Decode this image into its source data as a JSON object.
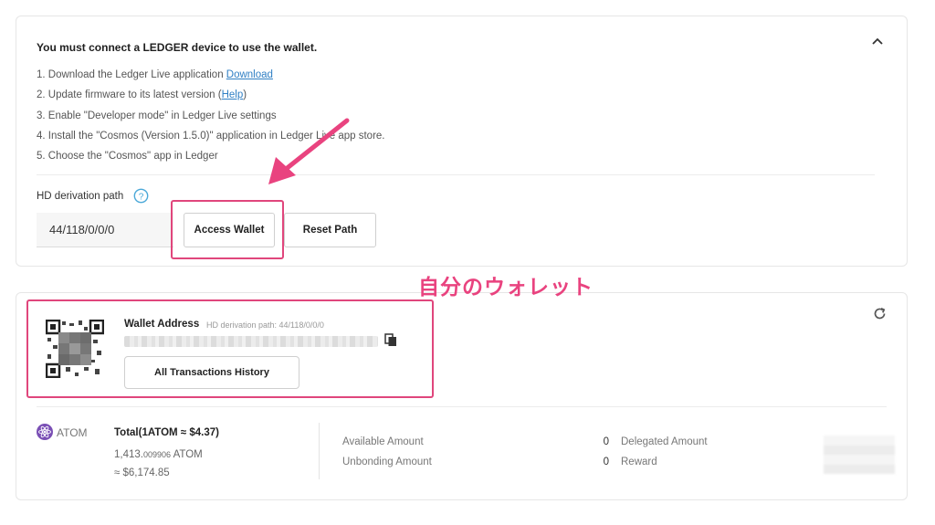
{
  "ledger": {
    "title": "You must connect a LEDGER device to use the wallet.",
    "steps": [
      {
        "text": "1. Download the Ledger Live application ",
        "link": "Download",
        "suffix": ""
      },
      {
        "text": "2. Update firmware to its latest version (",
        "link": "Help",
        "suffix": ")"
      },
      {
        "text": "3. Enable \"Developer mode\" in Ledger Live settings",
        "link": "",
        "suffix": ""
      },
      {
        "text": "4. Install the \"Cosmos (Version 1.5.0)\" application in Ledger Live app store.",
        "link": "",
        "suffix": ""
      },
      {
        "text": "5. Choose the \"Cosmos\" app in Ledger",
        "link": "",
        "suffix": ""
      }
    ],
    "hd_label": "HD derivation path",
    "hd_value": "44/118/0/0/0",
    "access_label": "Access Wallet",
    "reset_label": "Reset Path"
  },
  "annotation": {
    "label": "自分のウォレット",
    "color": "#e0467c"
  },
  "wallet": {
    "address_label": "Wallet Address",
    "hd_path_text": "HD derivation path: 44/118/0/0/0",
    "history_label": "All Transactions History"
  },
  "balance": {
    "token": "ATOM",
    "total_label": "Total(1ATOM ≈ $4.37)",
    "atom_amount_main": "1,413.",
    "atom_amount_small": "009906",
    "atom_amount_unit": " ATOM",
    "fiat_amount": "≈ $6,174.85",
    "available_label": "Available Amount",
    "available_value": "0",
    "unbonding_label": "Unbonding Amount",
    "unbonding_value": "0",
    "delegated_label": "Delegated Amount",
    "reward_label": "Reward"
  },
  "colors": {
    "accent_link": "#2f7fc4",
    "highlight": "#e0467c",
    "annotation_text": "#e9437f",
    "atom_icon": "#7a4fb5"
  },
  "icons": {
    "collapse": "chevron-up-icon",
    "help": "question-circle-icon",
    "copy": "copy-icon",
    "refresh": "refresh-icon",
    "token": "atom-icon"
  }
}
